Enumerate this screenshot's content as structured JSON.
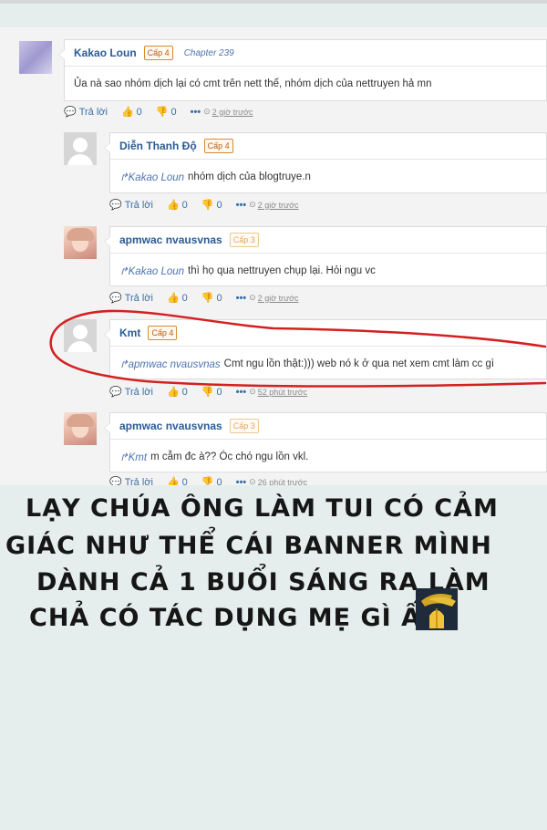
{
  "comments": [
    {
      "user": "Kakao Loun",
      "level": "Cấp 4",
      "chapter": "Chapter 239",
      "mention": "",
      "text": "Ủa nà sao nhóm dịch lại có cmt trên nett thế, nhóm dịch của nettruyen hả mn",
      "reply": "Trả lời",
      "likes": "0",
      "dislikes": "0",
      "more": "•••",
      "time": "2 giờ trước"
    },
    {
      "user": "Diễn Thanh Độ",
      "level": "Cấp 4",
      "mention": "Kakao Loun",
      "text": "nhóm dịch của blogtruye.n",
      "reply": "Trả lời",
      "likes": "0",
      "dislikes": "0",
      "more": "•••",
      "time": "2 giờ trước"
    },
    {
      "user": "apmwac nvausvnas",
      "level": "Cấp 3",
      "mention": "Kakao Loun",
      "text": "thì họ qua nettruyen chụp lại. Hỏi ngu vc",
      "reply": "Trả lời",
      "likes": "0",
      "dislikes": "0",
      "more": "•••",
      "time": "2 giờ trước"
    },
    {
      "user": "Kmt",
      "level": "Cấp 4",
      "mention": "apmwac nvausvnas",
      "text": "Cmt ngu lồn thật:))) web nó k ở qua net xem cmt làm cc gì",
      "reply": "Trả lời",
      "likes": "0",
      "dislikes": "0",
      "more": "•••",
      "time": "52 phút trước"
    },
    {
      "user": "apmwac nvausvnas",
      "level": "Cấp 3",
      "mention": "Kmt",
      "text": "m cẫm đc à?? Óc chó ngu lồn vkl.",
      "reply": "Trả lời",
      "likes": "0",
      "dislikes": "0",
      "more": "•••",
      "time": "26 phút trước"
    }
  ],
  "caption": [
    "LẠY CHÚA ÔNG LÀM TUI CÓ CẢM",
    "GIÁC NHƯ THỂ CÁI BANNER MÌNH",
    "DÀNH CẢ 1 BUỔI SÁNG RA LÀM",
    "CHẢ CÓ TÁC DỤNG MẸ GÌ ẤY"
  ],
  "colors": {
    "username": "#2a5b96",
    "level_border": "#d98b30",
    "annotation": "#d42020",
    "background": "#e5eeec"
  }
}
